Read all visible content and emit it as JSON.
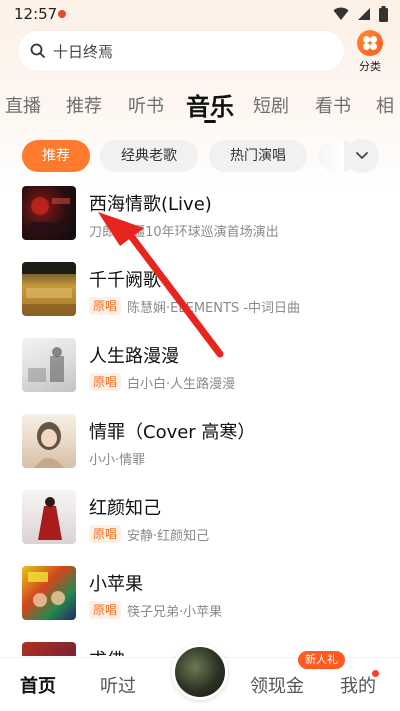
{
  "status_bar": {
    "time": "12:57",
    "icons": [
      "wifi-icon",
      "signal-icon",
      "battery-icon"
    ]
  },
  "search": {
    "placeholder": "十日终焉"
  },
  "category": {
    "label": "分类",
    "icon": "grid-dots-icon"
  },
  "top_tabs": [
    {
      "label": "直播"
    },
    {
      "label": "推荐"
    },
    {
      "label": "听书"
    },
    {
      "label": "音乐",
      "active": true
    },
    {
      "label": "短剧"
    },
    {
      "label": "看书"
    },
    {
      "label": "相"
    }
  ],
  "chips": [
    {
      "label": "推荐",
      "active": true
    },
    {
      "label": "经典老歌"
    },
    {
      "label": "热门演唱"
    }
  ],
  "songs": [
    {
      "title": "西海情歌(Live)",
      "tag": "",
      "subtitle": "刀郎·新疆10年环球巡演首场演出"
    },
    {
      "title": "千千阙歌",
      "tag": "原唱",
      "subtitle": "陈慧娴·ELEMENTS -中词日曲"
    },
    {
      "title": "人生路漫漫",
      "tag": "原唱",
      "subtitle": "白小白·人生路漫漫"
    },
    {
      "title": "情罪（Cover 高寒）",
      "tag": "",
      "subtitle": "小小·情罪"
    },
    {
      "title": "红颜知己",
      "tag": "原唱",
      "subtitle": "安静·红颜知己"
    },
    {
      "title": "小苹果",
      "tag": "原唱",
      "subtitle": "筷子兄弟·小苹果"
    },
    {
      "title": "求佛",
      "tag": "",
      "subtitle": ""
    }
  ],
  "bottom_nav": {
    "home": "首页",
    "listened": "听过",
    "earn": "领现金",
    "earn_badge": "新人礼",
    "mine": "我的"
  },
  "colors": {
    "accent": "#ff7a2f",
    "tag_text": "#ff6a1a",
    "tag_bg": "#fff0e6",
    "arrow": "#e8241e"
  }
}
